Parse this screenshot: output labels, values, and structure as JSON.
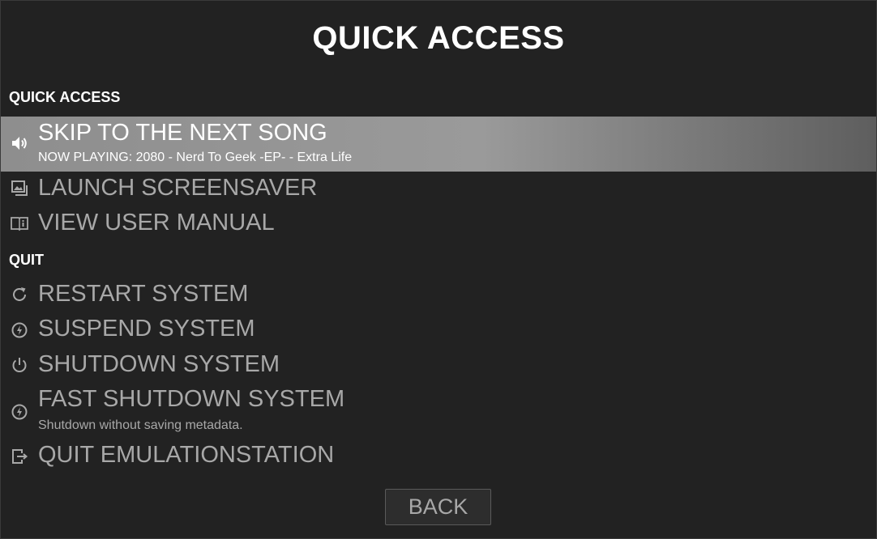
{
  "title": "QUICK ACCESS",
  "sections": {
    "quick_access": {
      "header": "QUICK ACCESS",
      "items": [
        {
          "icon": "speaker-icon",
          "label": "SKIP TO THE NEXT SONG",
          "sublabel": "NOW PLAYING: 2080 - Nerd To Geek -EP- - Extra Life",
          "selected": true
        },
        {
          "icon": "screensaver-icon",
          "label": "LAUNCH SCREENSAVER"
        },
        {
          "icon": "manual-icon",
          "label": "VIEW USER MANUAL"
        }
      ]
    },
    "quit": {
      "header": "QUIT",
      "items": [
        {
          "icon": "restart-icon",
          "label": "RESTART SYSTEM"
        },
        {
          "icon": "suspend-icon",
          "label": "SUSPEND SYSTEM"
        },
        {
          "icon": "power-icon",
          "label": "SHUTDOWN SYSTEM"
        },
        {
          "icon": "fast-shutdown-icon",
          "label": "FAST SHUTDOWN SYSTEM",
          "sublabel": "Shutdown without saving metadata."
        },
        {
          "icon": "exit-icon",
          "label": "QUIT EMULATIONSTATION"
        }
      ]
    }
  },
  "back_label": "BACK",
  "colors": {
    "background": "#222222",
    "text_primary": "#ffffff",
    "text_item": "#a8a8a8",
    "selection": "#9a9a9a"
  }
}
